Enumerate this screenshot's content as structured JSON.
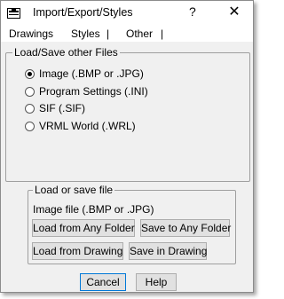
{
  "window": {
    "title": "Import/Export/Styles",
    "help_symbol": "?",
    "close_symbol": "✕"
  },
  "tabs": [
    {
      "label": "Drawings"
    },
    {
      "label": "Styles"
    },
    {
      "label": "Other"
    }
  ],
  "tab_separator": "|",
  "group_load_save": {
    "legend": "Load/Save other Files",
    "options": [
      {
        "label": "Image (.BMP or .JPG)",
        "checked": true
      },
      {
        "label": "Program Settings  (.INI)",
        "checked": false
      },
      {
        "label": "SIF (.SIF)",
        "checked": false
      },
      {
        "label": "VRML World  (.WRL)",
        "checked": false
      }
    ]
  },
  "group_file": {
    "legend": "Load or save file",
    "subtitle": "Image file (.BMP or .JPG)",
    "load_any_folder": "Load from Any Folder",
    "save_any_folder": "Save to Any Folder",
    "load_drawing": "Load from Drawing",
    "save_drawing": "Save in Drawing"
  },
  "footer": {
    "cancel": "Cancel",
    "help": "Help"
  }
}
